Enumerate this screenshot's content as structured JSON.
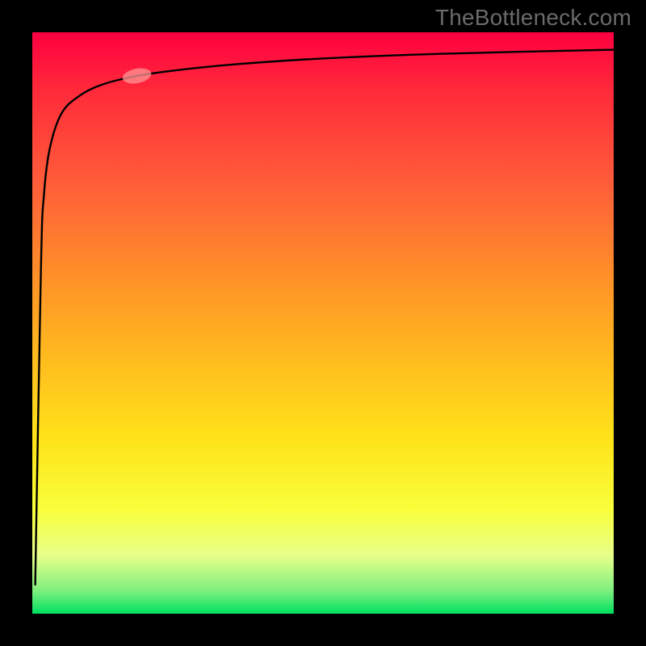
{
  "watermark": "TheBottleneck.com",
  "chart_data": {
    "type": "line",
    "title": "",
    "xlabel": "",
    "ylabel": "",
    "ylim": [
      0,
      100
    ],
    "xlim": [
      0,
      100
    ],
    "x": [
      0.5,
      1.5,
      2,
      3,
      5,
      8,
      12,
      18,
      25,
      35,
      50,
      70,
      100
    ],
    "values": [
      5,
      60,
      72,
      80,
      86,
      89,
      91,
      92.5,
      93.5,
      94.5,
      95.5,
      96.3,
      97
    ],
    "highlight_point": {
      "x": 18,
      "y": 92.5
    },
    "background_gradient": {
      "orientation": "vertical",
      "stops": [
        {
          "pos": 0,
          "color": "#ff0040"
        },
        {
          "pos": 10,
          "color": "#ff2a3a"
        },
        {
          "pos": 25,
          "color": "#ff5a3a"
        },
        {
          "pos": 40,
          "color": "#ff8a2a"
        },
        {
          "pos": 55,
          "color": "#ffb81f"
        },
        {
          "pos": 70,
          "color": "#ffe31a"
        },
        {
          "pos": 82,
          "color": "#f8ff3a"
        },
        {
          "pos": 90,
          "color": "#e8ff8a"
        },
        {
          "pos": 96,
          "color": "#7ff07f"
        },
        {
          "pos": 100,
          "color": "#00e060"
        }
      ]
    }
  }
}
